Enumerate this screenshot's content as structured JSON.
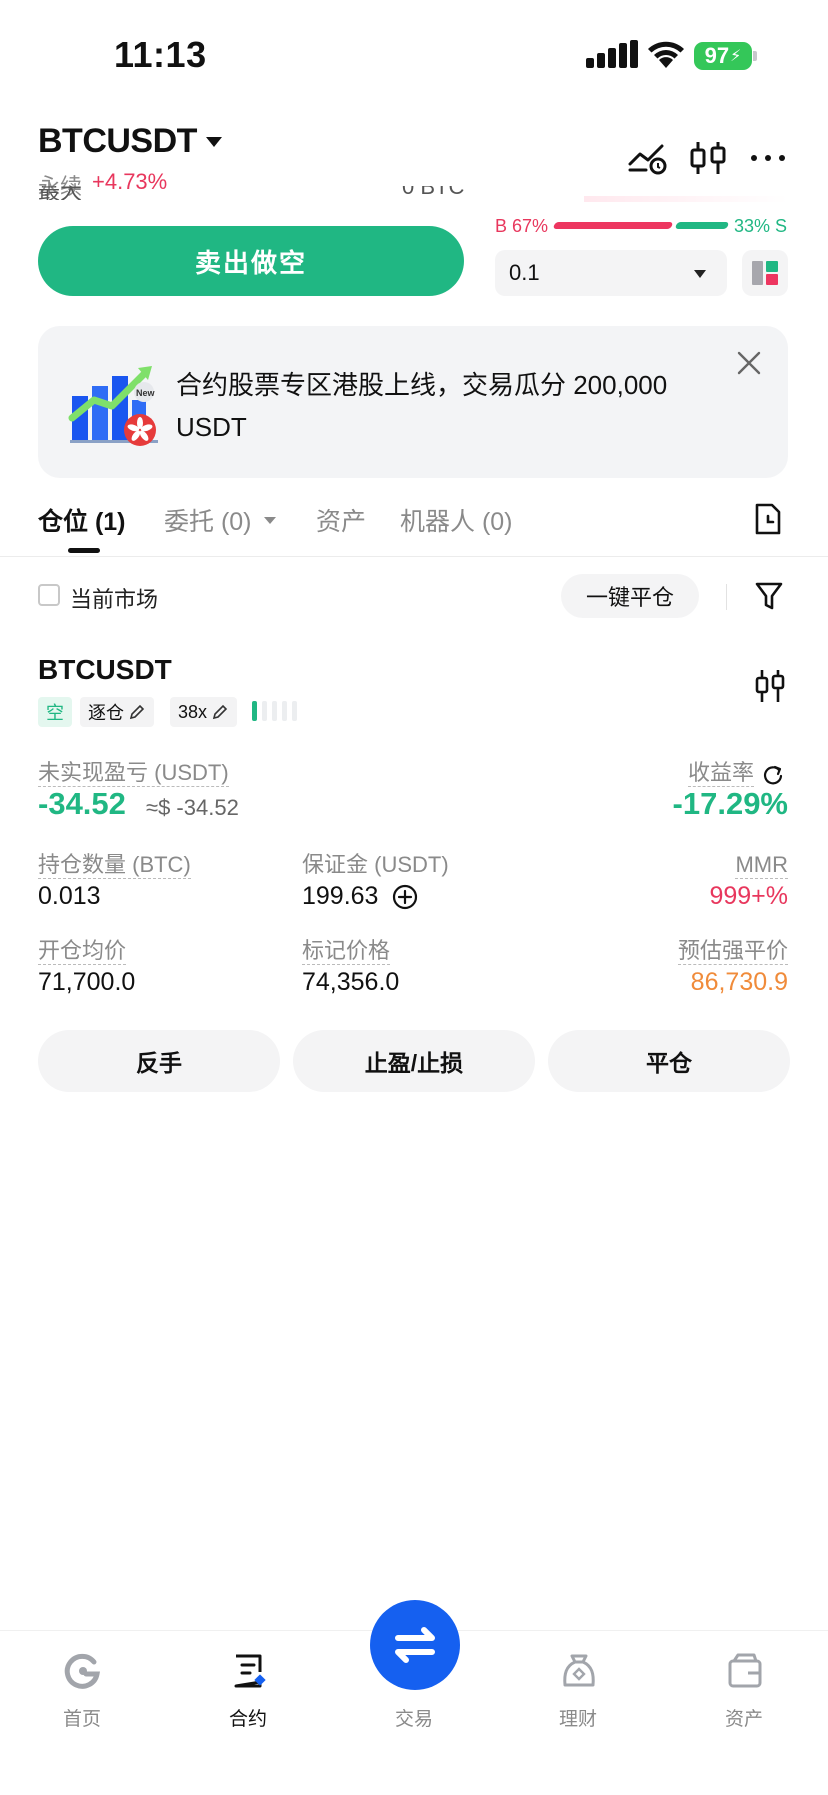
{
  "status_bar": {
    "time": "11:13",
    "battery": "97"
  },
  "header": {
    "pair": "BTCUSDT",
    "contract_type": "永续",
    "change": "+4.73%",
    "cut_label": "最大",
    "cut_value": "0 BTC"
  },
  "order": {
    "sell_label": "卖出做空",
    "buy_ratio": "B 67%",
    "sell_ratio": "33% S",
    "depth_step": "0.1"
  },
  "banner": {
    "text": "合约股票专区港股上线，交易瓜分 200,000 USDT",
    "badge": "New"
  },
  "tabs": [
    {
      "label": "仓位 (1)"
    },
    {
      "label": "委托 (0)"
    },
    {
      "label": "资产"
    },
    {
      "label": "机器人 (0)"
    }
  ],
  "filter": {
    "current_market": "当前市场",
    "close_all": "一键平仓"
  },
  "position": {
    "symbol": "BTCUSDT",
    "side_tag": "空",
    "margin_mode": "逐仓",
    "leverage": "38x",
    "unrealized_pnl_label": "未实现盈亏 (USDT)",
    "unrealized_pnl": "-34.52",
    "unrealized_pnl_usd": "≈$ -34.52",
    "roe_label": "收益率",
    "roe": "-17.29%",
    "size_label": "持仓数量 (BTC)",
    "size": "0.013",
    "margin_label": "保证金 (USDT)",
    "margin": "199.63",
    "mmr_label": "MMR",
    "mmr": "999+%",
    "entry_label": "开仓均价",
    "entry": "71,700.0",
    "mark_label": "标记价格",
    "mark": "74,356.0",
    "liq_label": "预估强平价",
    "liq": "86,730.9",
    "actions": {
      "reverse": "反手",
      "tp_sl": "止盈/止损",
      "close": "平仓"
    }
  },
  "colors": {
    "green": "#20b783",
    "red": "#e8375d",
    "orange": "#f08b3a",
    "blue": "#1560f0"
  },
  "bottom_nav": [
    {
      "label": "首页",
      "icon": "home-icon"
    },
    {
      "label": "合约",
      "icon": "futures-icon"
    },
    {
      "label": "交易",
      "icon": "swap-icon"
    },
    {
      "label": "理财",
      "icon": "earn-icon"
    },
    {
      "label": "资产",
      "icon": "wallet-icon"
    }
  ]
}
